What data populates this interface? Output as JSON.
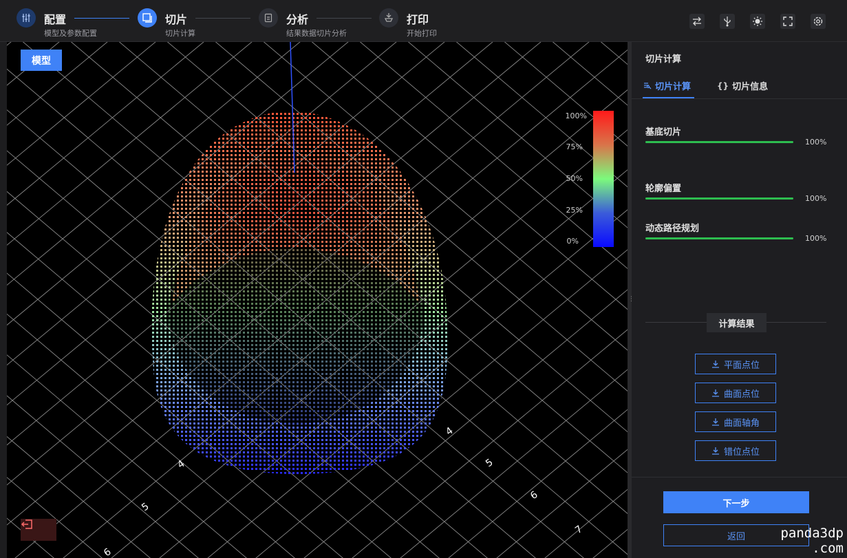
{
  "steps": [
    {
      "title": "配置",
      "subtitle": "模型及参数配置",
      "icon": "sliders-icon",
      "state": "done"
    },
    {
      "title": "切片",
      "subtitle": "切片计算",
      "icon": "layers-icon",
      "state": "active"
    },
    {
      "title": "分析",
      "subtitle": "结果数据切片分析",
      "icon": "document-icon",
      "state": "pending"
    },
    {
      "title": "打印",
      "subtitle": "开始打印",
      "icon": "print-icon",
      "state": "pending"
    }
  ],
  "toolbar": {
    "icons": [
      "swap-icon",
      "usb-icon",
      "brightness-icon",
      "fullscreen-icon",
      "settings-icon"
    ]
  },
  "viewport": {
    "model_button": "模型",
    "legend": [
      "100%",
      "75%",
      "50%",
      "25%",
      "0%"
    ],
    "axis_ticks": [
      "4",
      "5",
      "6",
      "4",
      "5",
      "6",
      "7"
    ],
    "exit_icon": "exit-icon"
  },
  "panel": {
    "title": "切片计算",
    "tabs": [
      {
        "label": "切片计算",
        "icon": "slice-icon",
        "active": true
      },
      {
        "label": "切片信息",
        "icon": "braces-icon",
        "active": false
      }
    ],
    "progress": [
      {
        "label": "基底切片",
        "value": 100,
        "text": "100%"
      },
      {
        "label": "轮廓偏置",
        "value": 100,
        "text": "100%"
      },
      {
        "label": "动态路径规划",
        "value": 100,
        "text": "100%"
      }
    ],
    "results_title": "计算结果",
    "downloads": [
      "平面点位",
      "曲面点位",
      "曲面轴角",
      "错位点位"
    ],
    "next_label": "下一步",
    "back_label": "返回"
  },
  "watermark": {
    "line1": "panda3dp",
    "line2": ".com"
  },
  "colors": {
    "accent": "#3f82f7",
    "progress": "#2dbd4f",
    "panel_bg": "#1e1e21",
    "viewport_bg": "#000000"
  }
}
